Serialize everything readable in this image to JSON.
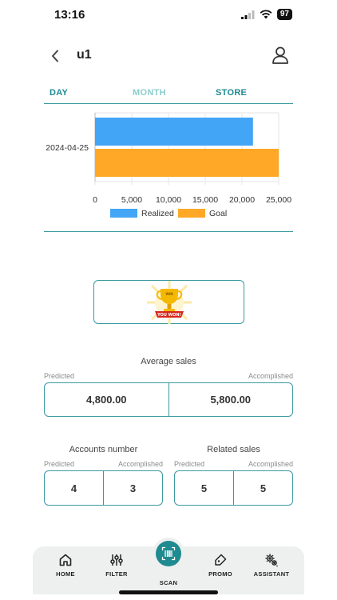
{
  "status": {
    "time": "13:16",
    "battery": "97"
  },
  "header": {
    "title": "u1"
  },
  "tabs": [
    {
      "label": "DAY"
    },
    {
      "label": "MONTH"
    },
    {
      "label": "STORE"
    }
  ],
  "chart_data": {
    "type": "bar",
    "orientation": "horizontal",
    "categories": [
      "2024-04-25"
    ],
    "series": [
      {
        "name": "Realized",
        "values": [
          21500
        ],
        "color": "#42a5f5"
      },
      {
        "name": "Goal",
        "values": [
          25000
        ],
        "color": "#ffa726"
      }
    ],
    "xlim": [
      0,
      25000
    ],
    "xticks": [
      "0",
      "5,000",
      "10,000",
      "15,000",
      "20,000",
      "25,000"
    ],
    "xtick_values": [
      0,
      5000,
      10000,
      15000,
      20000,
      25000
    ],
    "grid": true,
    "legend": "bottom"
  },
  "trophy": {
    "badge_text": "YOU WON!",
    "cup_text": "WIN"
  },
  "average_sales": {
    "title": "Average sales",
    "predicted_label": "Predicted",
    "accomplished_label": "Accomplished",
    "predicted": "4,800.00",
    "accomplished": "5,800.00"
  },
  "accounts_number": {
    "title": "Accounts number",
    "predicted_label": "Predicted",
    "accomplished_label": "Accomplished",
    "predicted": "4",
    "accomplished": "3"
  },
  "related_sales": {
    "title": "Related sales",
    "predicted_label": "Predicted",
    "accomplished_label": "Accomplished",
    "predicted": "5",
    "accomplished": "5"
  },
  "nav": {
    "home": "HOME",
    "filter": "FILTER",
    "scan": "SCAN",
    "promo": "PROMO",
    "assistant": "ASSISTANT"
  },
  "colors": {
    "accent": "#1f8a8f",
    "realized": "#42a5f5",
    "goal": "#ffa726"
  }
}
